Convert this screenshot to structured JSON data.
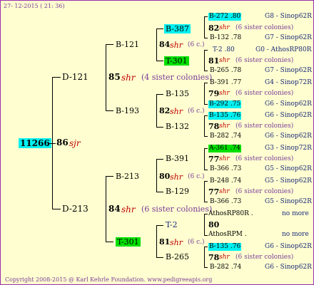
{
  "header_date": "27- 12-2015 ( 21: 36)",
  "footer": "Copyright 2008-2015 @ Karl Kehrle Foundation.   www.pedigreeapis.org",
  "root": {
    "id": "11266",
    "number": "86",
    "breed": "sjr"
  },
  "level1": [
    {
      "id": "D-121",
      "number": "85",
      "breed": "shr",
      "note": "(4 sister colonies)"
    },
    {
      "id": "D-213",
      "number": "84",
      "breed": "shr",
      "note": "(6 sister colonies)"
    }
  ],
  "level2": [
    {
      "id": "B-121",
      "number": "84",
      "breed": "shr",
      "note": "(6 c.)"
    },
    {
      "id": "B-193",
      "number": "82",
      "breed": "shr",
      "note": "(6 c.)"
    },
    {
      "id": "B-213",
      "number": "80",
      "breed": "shr",
      "note": "(6 c.)"
    },
    {
      "id": "T-301",
      "number": "81",
      "breed": "shr",
      "note": "(6 c.)"
    }
  ],
  "level3": [
    "B-387",
    "T-301",
    "B-135",
    "B-132",
    "B-391",
    "B-129",
    "T-2",
    "B-265"
  ],
  "level4": [
    {
      "top": "B-272 .80",
      "top_loc": "G8 - Sinop62R",
      "num": "82",
      "breed": "shr",
      "note": "(6 sister colonies)",
      "bottom": "B-132 .78",
      "bottom_loc": "G7 - Sinop62R"
    },
    {
      "top": "T-2 .80",
      "top_loc": "G0 - AthosRP80R",
      "num": "81",
      "breed": "shr",
      "note": "(6 sister colonies)",
      "bottom": "B-265 .78",
      "bottom_loc": "G7 - Sinop62R"
    },
    {
      "top": "B-391 .77",
      "top_loc": "G4 - Sinop72R",
      "num": "79",
      "breed": "shr",
      "note": "(6 sister colonies)",
      "bottom": "B-292 .75",
      "bottom_loc": "G6 - Sinop62R"
    },
    {
      "top": "B-135 .76",
      "top_loc": "G6 - Sinop62R",
      "num": "78",
      "breed": "shr",
      "note": "(6 sister colonies)",
      "bottom": "B-282 .74",
      "bottom_loc": "G6 - Sinop62R"
    },
    {
      "top": "A-361 .74",
      "top_loc": "G3 - Sinop72R",
      "num": "77",
      "breed": "shr",
      "note": "(6 sister colonies)",
      "bottom": "B-366 .73",
      "bottom_loc": "G5 - Sinop62R"
    },
    {
      "top": "B-248 .74",
      "top_loc": "G5 - Sinop62R",
      "num": "77",
      "breed": "shr",
      "note": "(6 sister colonies)",
      "bottom": "B-366 .73",
      "bottom_loc": "G5 - Sinop62R"
    },
    {
      "top": "AthosRP80R .",
      "top_loc": "no more",
      "num": "80",
      "breed": "",
      "note": "",
      "bottom": "AthosRPM .",
      "bottom_loc": "no more"
    },
    {
      "top": "B-135 .76",
      "top_loc": "G6 - Sinop62R",
      "num": "78",
      "breed": "shr",
      "note": "(6 sister colonies)",
      "bottom": "B-282 .74",
      "bottom_loc": "G6 - Sinop62R"
    }
  ],
  "colors": {
    "background": "#fefed0",
    "highlight_cyan": "#00f0f0",
    "highlight_green": "#00e000",
    "breed": "#c00000",
    "note": "#7a3b9a",
    "location": "#1b2a7a"
  }
}
